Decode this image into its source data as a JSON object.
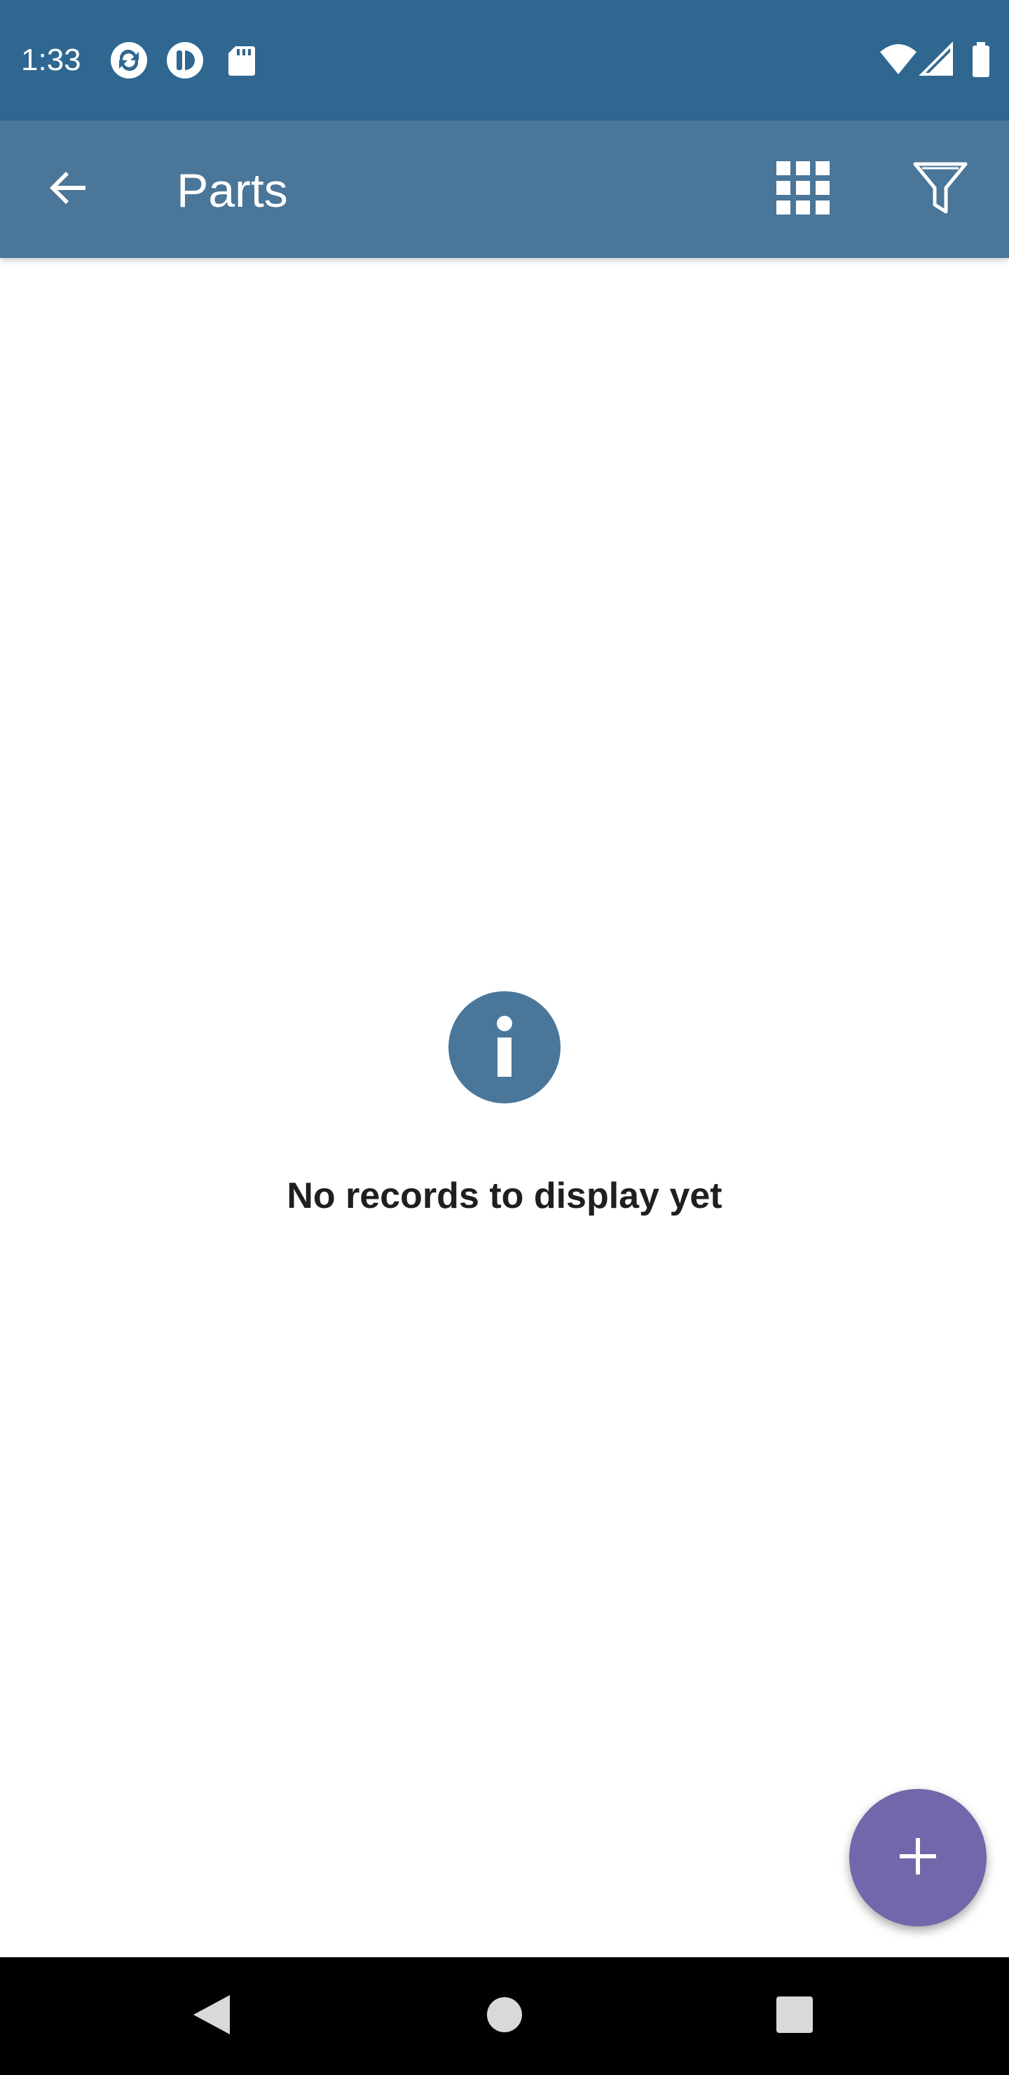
{
  "status_bar": {
    "time": "1:33",
    "left_icons": [
      "sync-icon",
      "app-icon",
      "sd-card-icon"
    ],
    "right_icons": [
      "wifi-icon",
      "cellular-signal-icon",
      "battery-icon"
    ]
  },
  "app_bar": {
    "title": "Parts",
    "actions": [
      "grid-view-icon",
      "filter-icon"
    ]
  },
  "empty_state": {
    "icon": "info-icon",
    "message": "No records to display yet"
  },
  "fab": {
    "icon": "plus-icon"
  },
  "nav_bar": {
    "buttons": [
      "back-triangle-icon",
      "home-circle-icon",
      "recents-square-icon"
    ]
  },
  "colors": {
    "status_bar": "#2f6791",
    "app_bar": "#4a7699",
    "info_icon": "#4a7699",
    "fab": "#7167aa",
    "nav_bar": "#000000"
  }
}
